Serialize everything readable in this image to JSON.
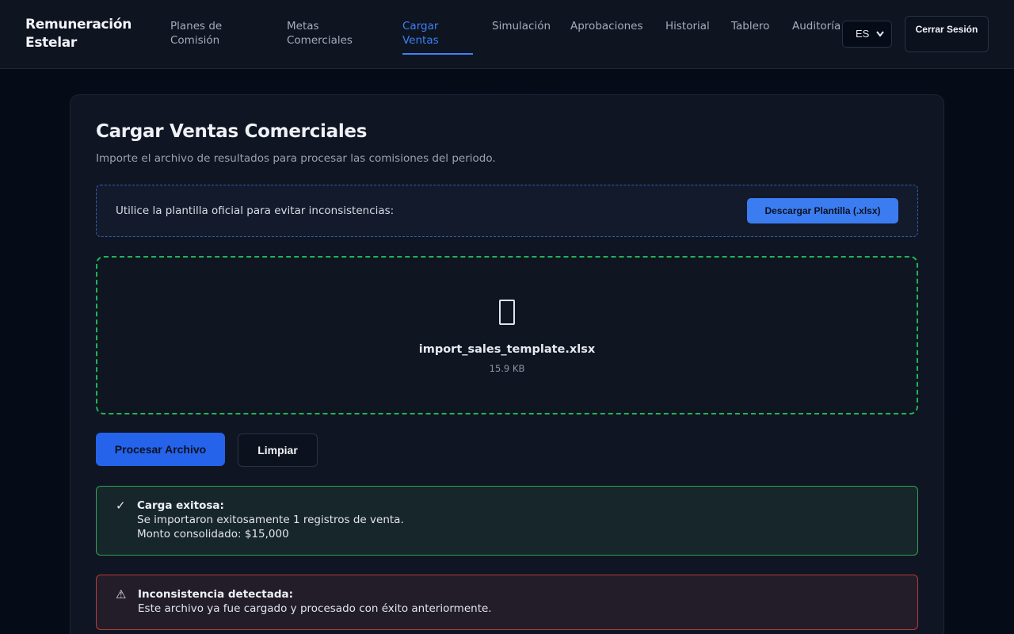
{
  "app": {
    "brand": "Remuneración Estelar"
  },
  "nav": {
    "items": [
      {
        "label": "Planes de Comisión"
      },
      {
        "label": "Metas Comerciales"
      },
      {
        "label": "Cargar Ventas",
        "active": true
      },
      {
        "label": "Simulación"
      },
      {
        "label": "Aprobaciones"
      },
      {
        "label": "Historial"
      },
      {
        "label": "Tablero"
      },
      {
        "label": "Auditoría"
      }
    ],
    "language": "ES",
    "logout_label": "Cerrar Sesión"
  },
  "page": {
    "title": "Cargar Ventas Comerciales",
    "subtitle": "Importe el archivo de resultados para procesar las comisiones del periodo."
  },
  "template": {
    "text": "Utilice la plantilla oficial para evitar inconsistencias:",
    "button_label": "Descargar Plantilla (.xlsx)"
  },
  "upload": {
    "file_icon": "file-icon",
    "file_name": "import_sales_template.xlsx",
    "file_size": "15.9 KB"
  },
  "actions": {
    "process_label": "Procesar Archivo",
    "clear_label": "Limpiar"
  },
  "alerts": {
    "success": {
      "icon": "✓",
      "title": "Carga exitosa:",
      "lines": [
        "Se importaron exitosamente 1 registros de venta.",
        "Monto consolidado: $15,000"
      ]
    },
    "error": {
      "icon": "⚠",
      "title": "Inconsistencia detectada:",
      "lines": [
        "Este archivo ya fue cargado y procesado con éxito anteriormente."
      ]
    }
  },
  "colors": {
    "accent": "#3b82f6",
    "success": "#22b455",
    "danger": "#b83a3a",
    "background": "#050b17"
  }
}
